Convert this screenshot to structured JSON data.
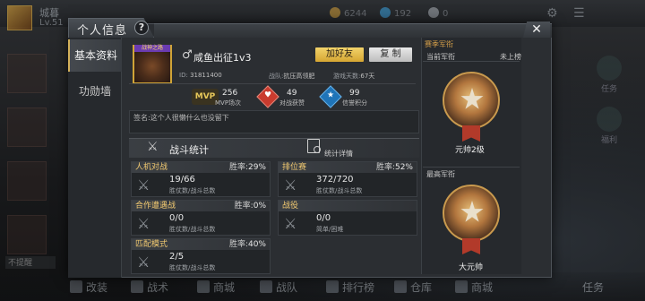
{
  "background": {
    "player_name": "城暮",
    "player_level": "Lv.51",
    "currency": [
      "6244",
      "192",
      "0"
    ],
    "left_tip": "不提醒",
    "right_side_items": [
      "任务",
      "福利"
    ],
    "bottom_nav": [
      "改装",
      "战术",
      "商城",
      "战队",
      "排行榜",
      "仓库",
      "商城",
      "任务"
    ]
  },
  "dialog": {
    "title": "个人信息",
    "help": "?",
    "close": "✕",
    "nav": [
      {
        "label": "基本资料",
        "active": true
      },
      {
        "label": "功勋墙",
        "active": false
      }
    ],
    "profile": {
      "avatar_badge": "战神之路",
      "gender_symbol": "♂",
      "name": "咸鱼出征1v3",
      "add_friend": "加好友",
      "copy": "复 制",
      "id_label": "ID:",
      "id_value": "31811400",
      "clan_label": "战队:",
      "clan_value": "抗压高领肥",
      "days_label": "游戏天数:",
      "days_value": "67天",
      "stats": [
        {
          "icon": "MVP",
          "value": "256",
          "label": "MVP场次"
        },
        {
          "icon": "heart",
          "value": "49",
          "label": "对战获赞"
        },
        {
          "icon": "star",
          "value": "99",
          "label": "信誉积分"
        }
      ],
      "signature_label": "签名:",
      "signature_text": "这个人很懒什么也没留下"
    },
    "battle": {
      "title": "战斗统计",
      "detail_label": "统计详情",
      "cards": [
        {
          "title": "人机对战",
          "rate_label": "胜率:",
          "rate": "29%",
          "value": "19/66",
          "sub": "胜仗数/战斗总数"
        },
        {
          "title": "排位赛",
          "rate_label": "胜率:",
          "rate": "52%",
          "value": "372/720",
          "sub": "胜仗数/战斗总数"
        },
        {
          "title": "合作遭遇战",
          "rate_label": "胜率:",
          "rate": "0%",
          "value": "0/0",
          "sub": "胜仗数/战斗总数"
        },
        {
          "title": "战役",
          "rate_label": "",
          "rate": "",
          "value": "0/0",
          "sub": "简单/困难"
        },
        {
          "title": "匹配模式",
          "rate_label": "胜率:",
          "rate": "40%",
          "value": "2/5",
          "sub": "胜仗数/战斗总数"
        }
      ]
    },
    "rank": {
      "season_label": "赛季军衔",
      "current_label": "当前军衔",
      "status": "未上榜",
      "current_rank": "元帅2级",
      "max_label": "最高军衔",
      "max_rank": "大元帅"
    }
  }
}
